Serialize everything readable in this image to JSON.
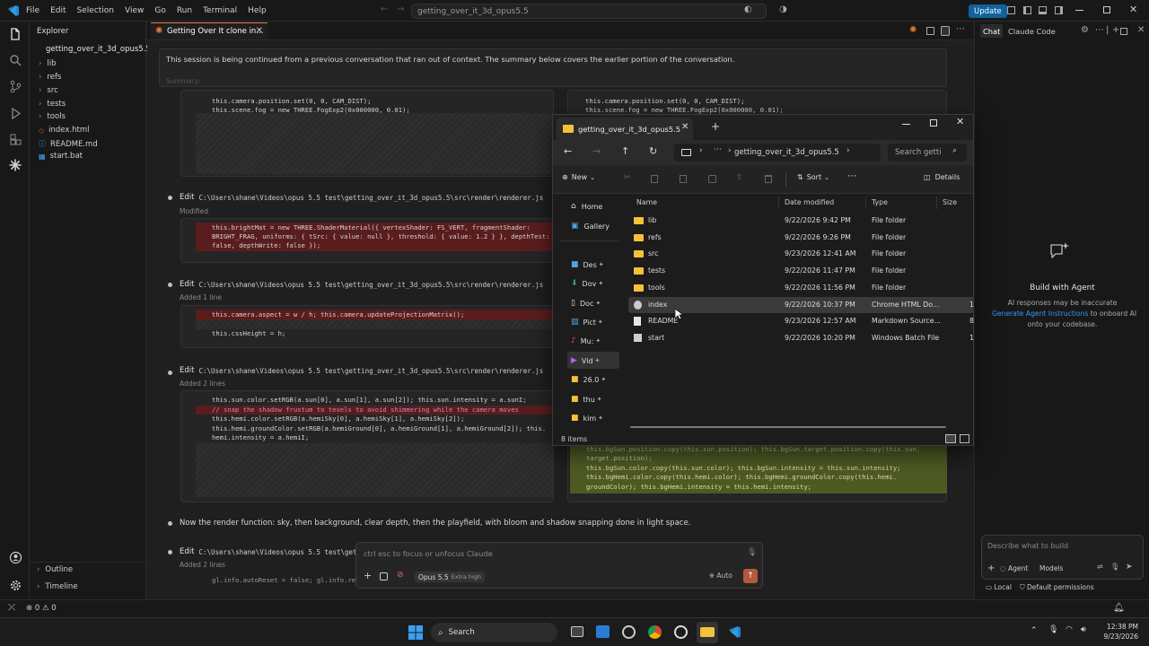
{
  "titlebar": {
    "menus": [
      "File",
      "Edit",
      "Selection",
      "View",
      "Go",
      "Run",
      "Terminal",
      "Help"
    ],
    "command_center": "getting_over_it_3d_opus5.5",
    "update_label": "Update"
  },
  "explorer": {
    "header": "Explorer",
    "root": "getting_over_it_3d_opus5.5",
    "folders": [
      "lib",
      "refs",
      "src",
      "tests",
      "tools"
    ],
    "files": [
      "index.html",
      "README.md",
      "start.bat"
    ],
    "outline": "Outline",
    "timeline": "Timeline"
  },
  "editor": {
    "tab_title": "Getting Over It clone in...",
    "summary_text": "This session is being continued from a previous conversation that ran out of context. The summary below covers the earlier portion of the conversation.",
    "summary_label": "Summary:",
    "block0_lines": [
      "this.camera.position.set(0, 0, CAM_DIST);",
      "this.scene.fog = new THREE.FogExp2(0x000000, 0.01);"
    ],
    "edit_label": "Edit",
    "path_full": "C:\\Users\\shane\\Videos\\opus 5.5 test\\getting_over_it_3d_opus5.5\\src\\render\\renderer.js",
    "path_partial": "C:\\Users\\shane\\Videos\\opus 5.5 test\\getting_",
    "edit1_status": "Modified",
    "edit1_lines": [
      "this.brightMat = new THREE.ShaderMaterial({ vertexShader: FS_VERT, fragmentShader:",
      "BRIGHT_FRAG, uniforms: { tSrc: { value: null }, threshold: { value: 1.2 } }, depthTest:",
      "false, depthWrite: false });"
    ],
    "edit2_status": "Added 1 line",
    "edit2_lines": [
      "this.camera.aspect = w / h; this.camera.updateProjectionMatrix();",
      "this.cssHeight = h;"
    ],
    "edit3_status": "Added 2 lines",
    "edit3_lines": [
      "this.sun.color.setRGB(a.sun[0], a.sun[1], a.sun[2]); this.sun.intensity = a.sunI;",
      "// snap the shadow frustum to texels to avoid shimmering while the camera moves",
      "this.hemi.color.setRGB(a.hemiSky[0], a.hemiSky[1], a.hemiSky[2]);",
      "this.hemi.groundColor.setRGB(a.hemiGround[0], a.hemiGround[1], a.hemiGround[2]); this.",
      "hemi.intensity = a.hemiI;"
    ],
    "right_lines": [
      "this.bgSun.position.copy(this.sun.position); this.bgSun.target.position.copy(this.sun.",
      "target.position);",
      "this.bgSun.color.copy(this.sun.color); this.bgSun.intensity = this.sun.intensity;",
      "this.bgHemi.color.copy(this.hemi.color); this.bgHemi.groundColor.copy(this.hemi.",
      "groundColor); this.bgHemi.intensity = this.hemi.intensity;"
    ],
    "narration": "Now the render function: sky, then background, clear depth, then the playfield, with bloom and shadow snapping done in light space.",
    "edit4_status": "Added 2 lines",
    "bottom_line": "gl.info.autoReset = false; gl.info.re",
    "input_placeholder": "ctrl esc to focus or unfocus Claude",
    "model_name": "Opus 5.5",
    "model_badge": "Extra high",
    "auto_label": "Auto"
  },
  "chat": {
    "tab_chat": "Chat",
    "tab_claude": "Claude Code",
    "build_title": "Build with Agent",
    "disclaimer": "AI responses may be inaccurate",
    "link": "Generate Agent Instructions",
    "suffix1": "to onboard AI",
    "suffix2": "onto your codebase.",
    "input_placeholder": "Describe what to build",
    "agent_label": "Agent",
    "models_label": "Models",
    "local_label": "Local",
    "permissions_label": "Default permissions"
  },
  "file_explorer": {
    "tab_title": "getting_over_it_3d_opus5.5",
    "breadcrumb": "getting_over_it_3d_opus5.5",
    "search_placeholder": "Search getti",
    "new_label": "New",
    "sort_label": "Sort",
    "details_label": "Details",
    "columns": [
      "Name",
      "Date modified",
      "Type",
      "Size"
    ],
    "sidebar": [
      "Home",
      "Gallery",
      "Des",
      "Dov",
      "Doc",
      "Pict",
      "Mu:",
      "Vid",
      "26.0",
      "thu",
      "kim"
    ],
    "rows": [
      {
        "name": "lib",
        "date": "9/22/2026 9:42 PM",
        "type": "File folder",
        "size": "",
        "kind": "folder"
      },
      {
        "name": "refs",
        "date": "9/22/2026 9:26 PM",
        "type": "File folder",
        "size": "",
        "kind": "folder"
      },
      {
        "name": "src",
        "date": "9/23/2026 12:41 AM",
        "type": "File folder",
        "size": "",
        "kind": "folder"
      },
      {
        "name": "tests",
        "date": "9/22/2026 11:47 PM",
        "type": "File folder",
        "size": "",
        "kind": "folder"
      },
      {
        "name": "tools",
        "date": "9/22/2026 11:56 PM",
        "type": "File folder",
        "size": "",
        "kind": "folder"
      },
      {
        "name": "index",
        "date": "9/22/2026 10:37 PM",
        "type": "Chrome HTML Do...",
        "size": "1",
        "kind": "html"
      },
      {
        "name": "README",
        "date": "9/23/2026 12:57 AM",
        "type": "Markdown Source...",
        "size": "8",
        "kind": "md"
      },
      {
        "name": "start",
        "date": "9/22/2026 10:20 PM",
        "type": "Windows Batch File",
        "size": "1",
        "kind": "bat"
      }
    ],
    "status": "8 items"
  },
  "statusbar": {
    "problems": "0",
    "warnings": "0"
  },
  "taskbar": {
    "search": "Search",
    "time": "12:38 PM",
    "date": "9/23/2026"
  },
  "colors": {
    "accent": "#0e639c",
    "claude_orange": "#e87a3c",
    "deleted_bg": "#5a1d1d",
    "added_bg": "#4e5a23",
    "link": "#3794ff"
  }
}
